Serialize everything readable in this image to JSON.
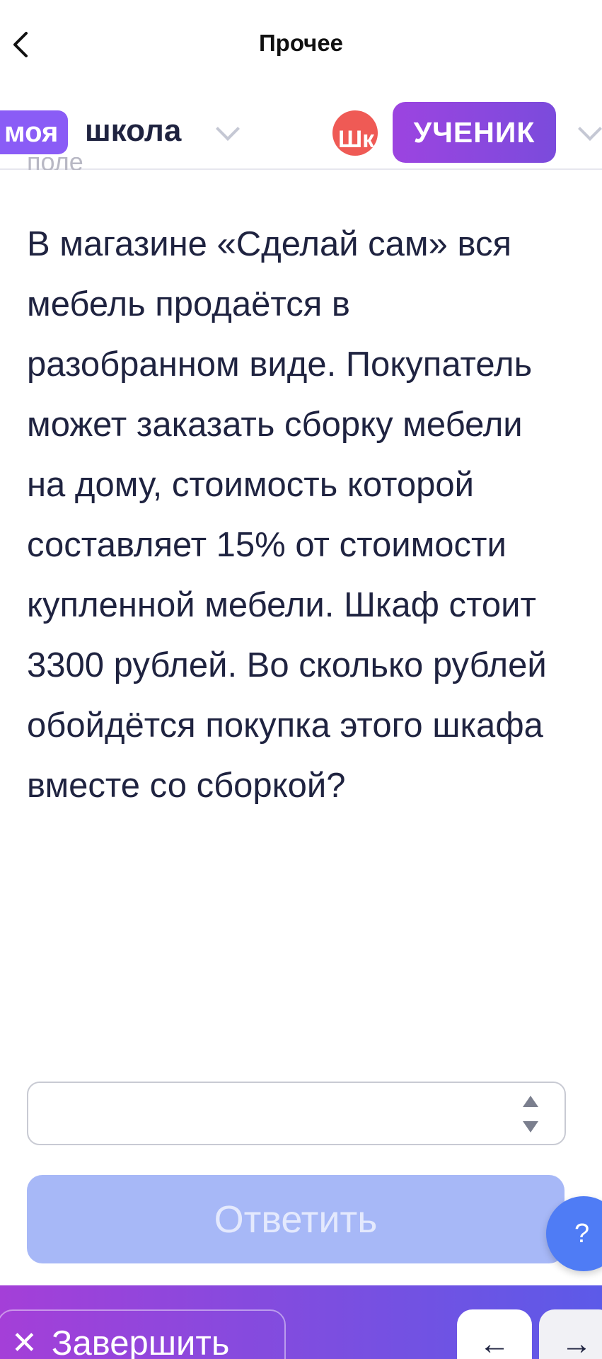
{
  "topbar": {
    "title": "Прочее",
    "back_icon": "chevron-left-icon"
  },
  "school_header": {
    "logo_part1": "моя",
    "logo_part2": "школа",
    "avatar_text": "Шк",
    "role_label": "УЧЕНИК",
    "colors": {
      "logo": "#8a5cf6",
      "role_badge": "#7b4bdc",
      "avatar": "#ef5a55"
    }
  },
  "cut_off_text": "поле",
  "question": {
    "text": "В магазине «Сделай сам» вся мебель продаётся в разобранном виде. Покупатель может заказать сборку мебели на дому, стоимость которой составляет 15% от стоимости купленной мебели. Шкаф стоит 3300 рублей. Во сколько рублей обойдётся покупка этого шкафа вместе со сборкой?"
  },
  "answer": {
    "value": "",
    "placeholder": ""
  },
  "submit_label": "Ответить",
  "help_label": "?",
  "bottombar": {
    "finish_icon": "close-icon",
    "finish_label": "Завершить",
    "prev_icon": "←",
    "next_icon": "→"
  },
  "colors": {
    "submit_disabled": "#a7b8f7",
    "help": "#4f7cf5",
    "bottombar_gradient": [
      "#a43fd8",
      "#5c5ae8"
    ]
  }
}
